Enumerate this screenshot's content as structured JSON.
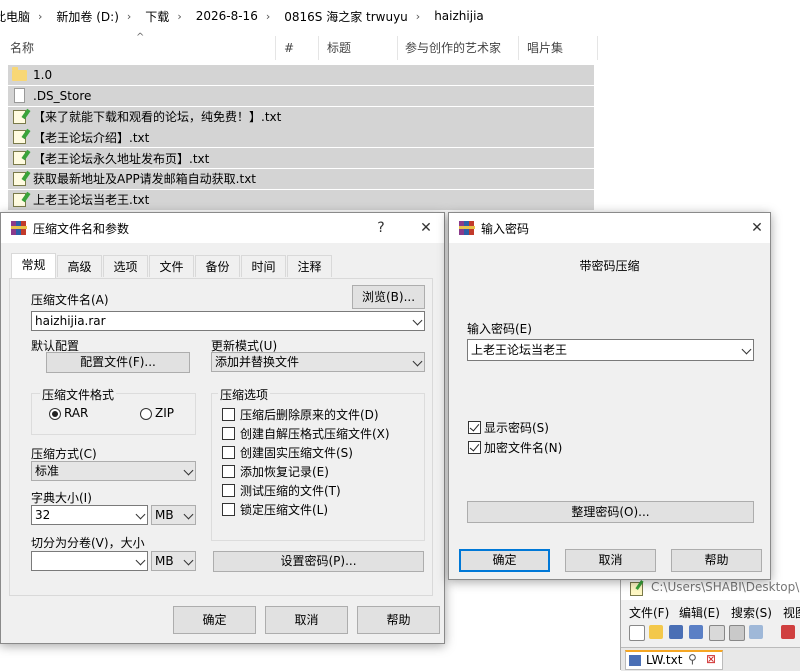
{
  "explorer": {
    "breadcrumb": [
      "此电脑",
      "新加卷 (D:)",
      "下载",
      "2026-8-16",
      "0816S 海之家 trwuyu",
      "haizhijia"
    ],
    "columns": [
      "名称",
      "#",
      "标题",
      "参与创作的艺术家",
      "唱片集"
    ],
    "files": [
      {
        "name": "1.0",
        "icon": "folder-icon"
      },
      {
        "name": ".DS_Store",
        "icon": "file-icon"
      },
      {
        "name": "【来了就能下载和观看的论坛，纯免费！】.txt",
        "icon": "text-file-icon"
      },
      {
        "name": "【老王论坛介绍】.txt",
        "icon": "text-file-icon"
      },
      {
        "name": "【老王论坛永久地址发布页】.txt",
        "icon": "text-file-icon"
      },
      {
        "name": "获取最新地址及APP请发邮箱自动获取.txt",
        "icon": "text-file-icon"
      },
      {
        "name": "上老王论坛当老王.txt",
        "icon": "text-file-icon"
      }
    ]
  },
  "archive_dialog": {
    "title": "压缩文件名和参数",
    "help": "?",
    "close": "✕",
    "tabs": [
      "常规",
      "高级",
      "选项",
      "文件",
      "备份",
      "时间",
      "注释"
    ],
    "archive_name_label": "压缩文件名(A)",
    "browse": "浏览(B)...",
    "archive_name": "haizhijia.rar",
    "default_profile_label": "默认配置",
    "profiles_button": "配置文件(F)...",
    "update_mode_label": "更新模式(U)",
    "update_mode": "添加并替换文件",
    "format_label": "压缩文件格式",
    "format_rar": "RAR",
    "format_zip": "ZIP",
    "method_label": "压缩方式(C)",
    "method": "标准",
    "dict_label": "字典大小(I)",
    "dict_value": "32",
    "dict_unit": "MB",
    "split_label": "切分为分卷(V)，大小",
    "split_value": "",
    "split_unit": "MB",
    "options_label": "压缩选项",
    "options": [
      {
        "label": "压缩后删除原来的文件(D)",
        "checked": false
      },
      {
        "label": "创建自解压格式压缩文件(X)",
        "checked": false
      },
      {
        "label": "创建固实压缩文件(S)",
        "checked": false
      },
      {
        "label": "添加恢复记录(E)",
        "checked": false
      },
      {
        "label": "测试压缩的文件(T)",
        "checked": false
      },
      {
        "label": "锁定压缩文件(L)",
        "checked": false
      }
    ],
    "set_password": "设置密码(P)...",
    "ok": "确定",
    "cancel": "取消",
    "help_btn": "帮助"
  },
  "password_dialog": {
    "title": "输入密码",
    "close": "✕",
    "heading": "带密码压缩",
    "password_label": "输入密码(E)",
    "password_value": "上老王论坛当老王",
    "show_password": "显示密码(S)",
    "encrypt_names": "加密文件名(N)",
    "organize": "整理密码(O)...",
    "ok": "确定",
    "cancel": "取消",
    "help": "帮助"
  },
  "notepad": {
    "title": "C:\\Users\\SHABI\\Desktop\\L",
    "menu": [
      "文件(F)",
      "编辑(E)",
      "搜索(S)",
      "视图"
    ],
    "tab": "LW.txt",
    "tab_pin": "⚲",
    "tab_close": "⊠"
  },
  "colors": {
    "selection": "#d4d4d4",
    "default_border": "#0078d7",
    "dialog_bg": "#f0f0f0"
  }
}
